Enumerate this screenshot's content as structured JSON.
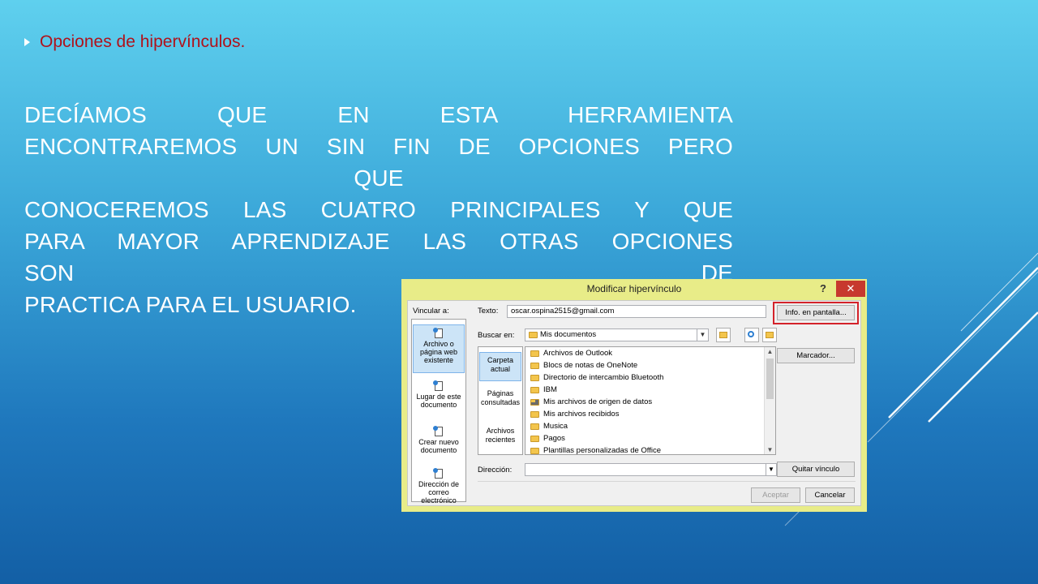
{
  "slide": {
    "bullet": "Opciones de hipervínculos.",
    "paragraph_lines": [
      "DECÍAMOS QUE EN ESTA HERRAMIENTA",
      "ENCONTRAREMOS UN SIN FIN DE OPCIONES PERO",
      "QUE",
      "CONOCEREMOS LAS CUATRO PRINCIPALES Y QUE",
      "PARA MAYOR APRENDIZAJE LAS OTRAS OPCIONES",
      "SON DE",
      "PRACTICA PARA EL USUARIO."
    ],
    "colors": {
      "bullet_text": "#b0121b",
      "body_text": "#ffffff",
      "dialog_border": "#e8ec88",
      "highlight": "#d4222a"
    }
  },
  "dialog": {
    "title": "Modificar hipervínculo",
    "help": "?",
    "close": "✕",
    "link_to_label": "Vincular a:",
    "text_label": "Texto:",
    "text_value": "oscar.ospina2515@gmail.com",
    "screen_tip_button": "Info. en pantalla...",
    "look_in_label": "Buscar en:",
    "look_in_value": "Mis documentos",
    "bookmark_button": "Marcador...",
    "address_label": "Dirección:",
    "address_value": "",
    "remove_link_button": "Quitar vínculo",
    "ok_button": "Aceptar",
    "cancel_button": "Cancelar",
    "link_to_items": [
      "Archivo o página web existente",
      "Lugar de este documento",
      "Crear nuevo documento",
      "Dirección de correo electrónico"
    ],
    "nav_items": [
      "Carpeta actual",
      "Páginas consultadas",
      "Archivos recientes"
    ],
    "files": [
      "Archivos de Outlook",
      "Blocs de notas de OneNote",
      "Directorio de intercambio Bluetooth",
      "IBM",
      "Mis archivos de origen de datos",
      "Mis archivos recibidos",
      "Musica",
      "Pagos",
      "Plantillas personalizadas de Office"
    ],
    "icons": {
      "dropdown": "chevron-down-icon",
      "folder_browse": "folder-open-icon",
      "web_browse": "globe-search-icon",
      "scroll_up": "▲",
      "scroll_down": "▼"
    }
  }
}
